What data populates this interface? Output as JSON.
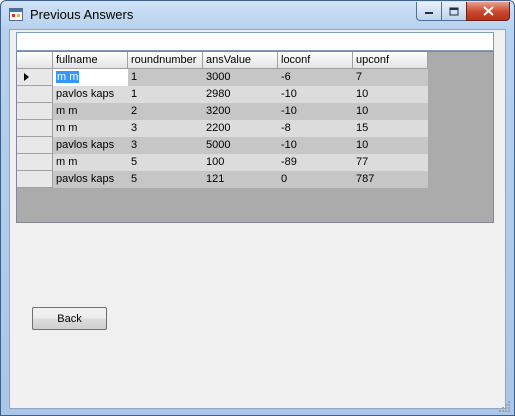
{
  "window": {
    "title": "Previous Answers",
    "controls": {
      "minimize": "minimize-icon",
      "maximize": "maximize-icon",
      "close": "close-icon"
    }
  },
  "grid": {
    "columns": [
      "fullname",
      "roundnumber",
      "ansValue",
      "loconf",
      "upconf"
    ],
    "rows": [
      [
        "m m",
        "1",
        "3000",
        "-6",
        "7"
      ],
      [
        "pavlos kaps",
        "1",
        "2980",
        "-10",
        "10"
      ],
      [
        "m m",
        "2",
        "3200",
        "-10",
        "10"
      ],
      [
        "m m",
        "3",
        "2200",
        "-8",
        "15"
      ],
      [
        "pavlos kaps",
        "3",
        "5000",
        "-10",
        "10"
      ],
      [
        "m m",
        "5",
        "100",
        "-89",
        "77"
      ],
      [
        "pavlos kaps",
        "5",
        "121",
        "0",
        "787"
      ]
    ],
    "current_row_indicator": "row-pointer-icon"
  },
  "back_button": {
    "label": "Back"
  },
  "colors": {
    "title_bar": "#b7d1ee",
    "client_bg": "#f0f0f0",
    "grid_bg": "#ababab",
    "selection": "#3399ff",
    "close_button": "#c9462c"
  }
}
